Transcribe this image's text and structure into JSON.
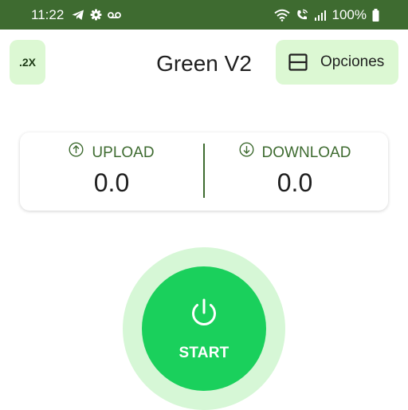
{
  "status_bar": {
    "time": "11:22",
    "battery_text": "100%",
    "left_icons": [
      "telegram-icon",
      "gear-icon",
      "voicemail-icon"
    ],
    "right_icons": [
      "wifi-icon",
      "wifi-calling-icon",
      "signal-icon",
      "battery-icon"
    ],
    "background": "#3e6b30"
  },
  "header": {
    "speed_label": ".2X",
    "title": "Green V2",
    "options_label": "Opciones"
  },
  "stats": {
    "upload": {
      "label": "UPLOAD",
      "value": "0.0",
      "icon": "arrow-up-circle-icon"
    },
    "download": {
      "label": "DOWNLOAD",
      "value": "0.0",
      "icon": "arrow-down-circle-icon"
    }
  },
  "start_button": {
    "label": "START",
    "icon": "power-icon"
  },
  "colors": {
    "accent": "#3e6b30",
    "button_light": "#dcf8d3",
    "start_green": "#1ad05c",
    "start_halo": "#d6f7d6"
  }
}
